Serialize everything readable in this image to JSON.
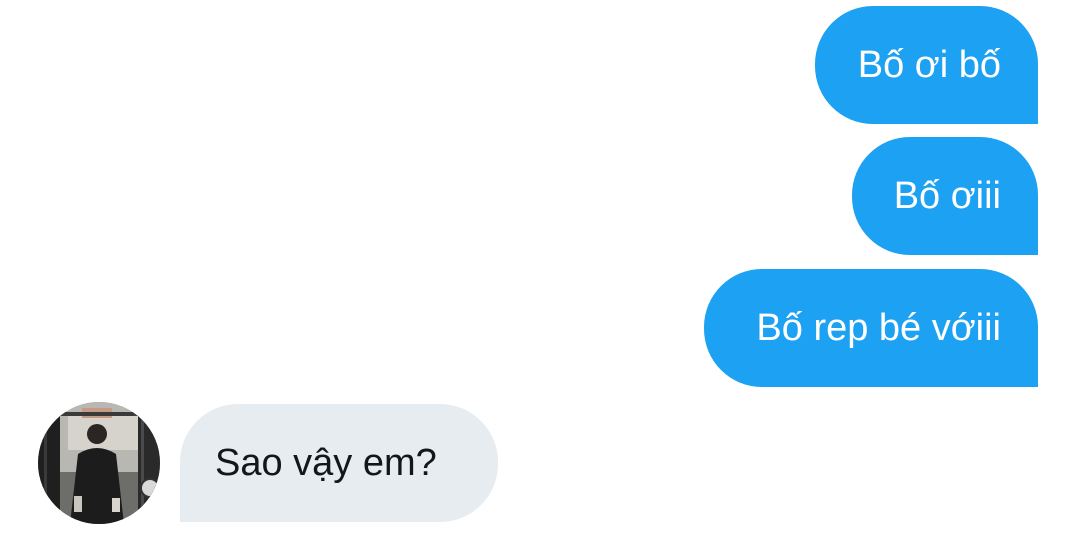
{
  "conversation": {
    "messages": [
      {
        "direction": "outgoing",
        "text": "Bố ơi bố"
      },
      {
        "direction": "outgoing",
        "text": "Bố ơiii"
      },
      {
        "direction": "outgoing",
        "text": "Bố rep bé vớiii"
      },
      {
        "direction": "incoming",
        "text": "Sao vậy em?"
      }
    ],
    "colors": {
      "outgoing_bubble": "#1da1f2",
      "outgoing_text": "#ffffff",
      "incoming_bubble": "#e6ecf0",
      "incoming_text": "#14171a",
      "background": "#ffffff"
    },
    "sender_avatar_icon": "person-photo-avatar"
  }
}
